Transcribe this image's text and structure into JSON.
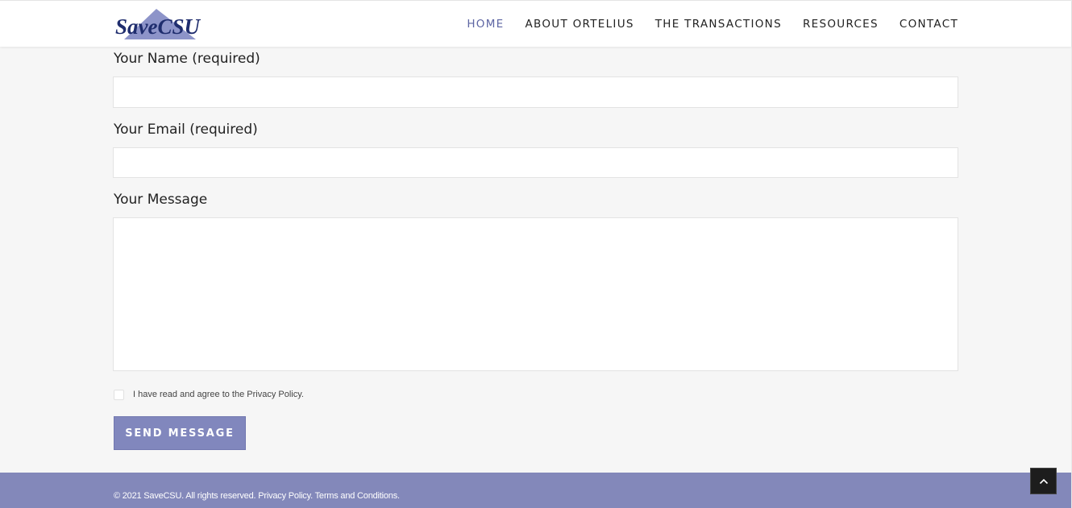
{
  "header": {
    "logo_text": "SaveCSU",
    "nav": [
      {
        "label": "HOME",
        "active": true
      },
      {
        "label": "ABOUT ORTELIUS",
        "active": false
      },
      {
        "label": "THE TRANSACTIONS",
        "active": false
      },
      {
        "label": "RESOURCES",
        "active": false
      },
      {
        "label": "CONTACT",
        "active": false
      }
    ]
  },
  "form": {
    "name_label": "Your Name (required)",
    "name_value": "",
    "email_label": "Your Email (required)",
    "email_value": "",
    "message_label": "Your Message",
    "message_value": "",
    "consent_text": "I have read and agree to the Privacy Policy.",
    "consent_checked": false,
    "submit_label": "SEND MESSAGE"
  },
  "footer": {
    "copyright": "© 2021 SaveCSU. All rights reserved.",
    "privacy_link": "Privacy Policy.",
    "terms_link": "Terms and Conditions."
  },
  "icons": {
    "scroll_top": "chevron-up-icon"
  },
  "colors": {
    "accent": "#8388ba",
    "nav_active": "#5d65a3",
    "logo_text": "#1f2d6e"
  }
}
